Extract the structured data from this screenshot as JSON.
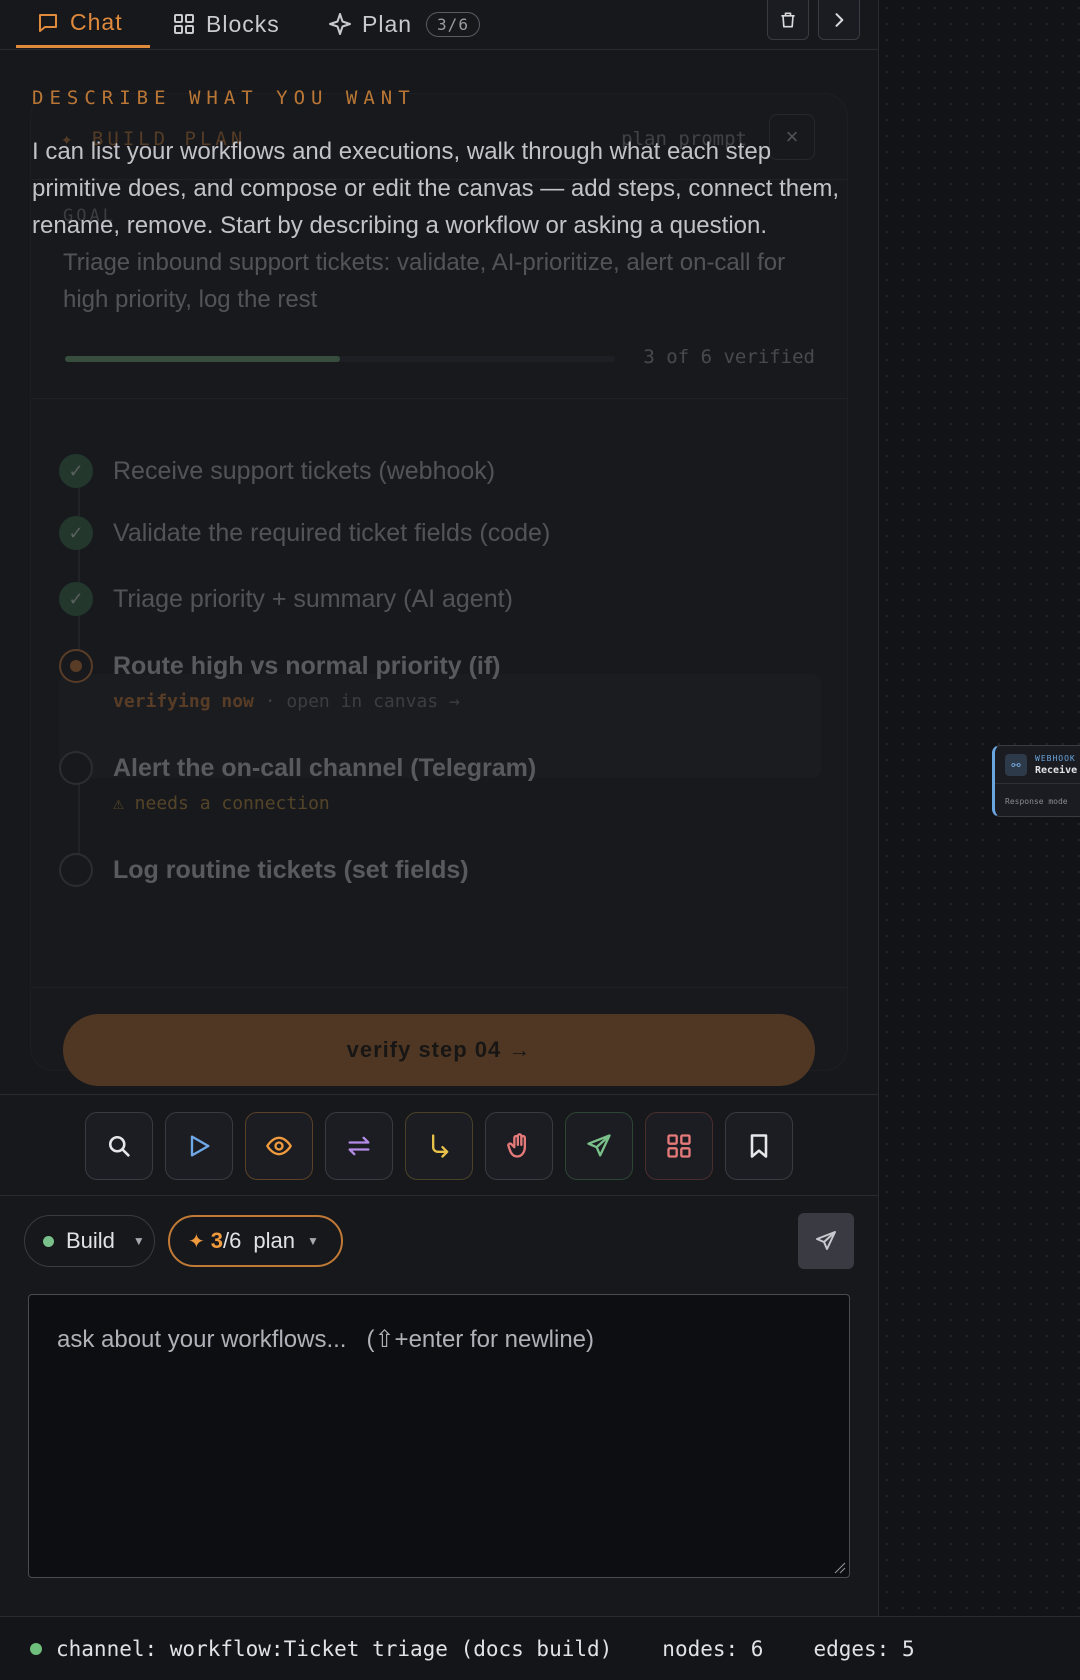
{
  "tabs": [
    {
      "label": "Chat"
    },
    {
      "label": "Blocks"
    },
    {
      "label": "Plan",
      "badge": "3/6"
    }
  ],
  "chat": {
    "heading": "DESCRIBE WHAT YOU WANT",
    "intro": "I can list your workflows and executions, walk through what each step primitive does, and compose or edit the canvas — add steps, connect them, rename, remove. Start by describing a workflow or asking a question."
  },
  "plan_card": {
    "title": "✦ BUILD PLAN",
    "subtitle": "plan prompt",
    "close": "×",
    "goal_label": "GOAL",
    "goal": "Triage inbound support tickets: validate, AI-prioritize, alert on-call for high priority, log the rest",
    "progress": {
      "verified": 3,
      "total": 6,
      "label": "3 of 6 verified"
    },
    "steps": [
      {
        "label": "Receive support tickets (webhook)",
        "status": "done"
      },
      {
        "label": "Validate the required ticket fields (code)",
        "status": "done"
      },
      {
        "label": "Triage priority + summary (AI agent)",
        "status": "done"
      },
      {
        "label": "Route high vs normal priority (if)",
        "status": "active",
        "meta_hl": "verifying now",
        "meta": " · open in canvas →"
      },
      {
        "label": "Alert the on-call channel (Telegram)",
        "status": "pending",
        "meta": "⚠ needs a connection"
      },
      {
        "label": "Log routine tickets (set fields)",
        "status": "pending"
      }
    ],
    "verify_button": "verify step 04 →"
  },
  "tools": [
    {
      "name": "search-icon",
      "color": "#e6e6ea"
    },
    {
      "name": "play-icon",
      "color": "#6fa8e6"
    },
    {
      "name": "eye-icon",
      "color": "#f09a3e"
    },
    {
      "name": "swap-icon",
      "color": "#b48be8"
    },
    {
      "name": "branch-icon",
      "color": "#e8c14a"
    },
    {
      "name": "hand-icon",
      "color": "#e57a7a"
    },
    {
      "name": "send-icon",
      "color": "#7ac08a"
    },
    {
      "name": "grid-icon",
      "color": "#e57a7a"
    },
    {
      "name": "bookmark-icon",
      "color": "#e6e6ea"
    }
  ],
  "composer": {
    "mode_chip": "Build",
    "plan_chip": {
      "current": "3",
      "total": "/6",
      "label": "plan"
    },
    "placeholder": "ask about your workflows...   (⇧+enter for newline)"
  },
  "status": {
    "channel": "channel: workflow:Ticket triage (docs build)",
    "nodes": "nodes: 6",
    "edges": "edges: 5"
  },
  "canvas_node": {
    "type": "WEBHOOK",
    "name": "Receive",
    "meta": "Response mode"
  },
  "colors": {
    "accent": "#e08a3c",
    "success": "#7ac08a",
    "background": "#17181c"
  }
}
